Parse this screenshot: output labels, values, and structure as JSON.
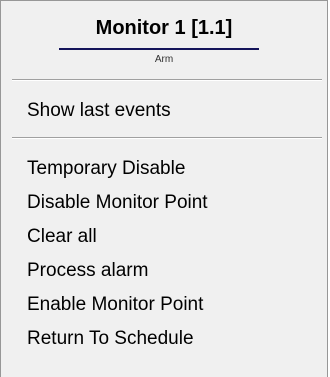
{
  "header": {
    "title": "Monitor 1 [1.1]",
    "subtitle": "Arm"
  },
  "menu": {
    "top_items": [
      {
        "label": "Show last events"
      }
    ],
    "items": [
      {
        "label": "Temporary Disable"
      },
      {
        "label": "Disable Monitor Point"
      },
      {
        "label": "Clear all"
      },
      {
        "label": "Process alarm"
      },
      {
        "label": "Enable Monitor Point"
      },
      {
        "label": "Return To Schedule"
      }
    ]
  },
  "colors": {
    "background": "#f0f0f0",
    "title_underline": "#14145a",
    "separator": "#a0a0a0"
  }
}
